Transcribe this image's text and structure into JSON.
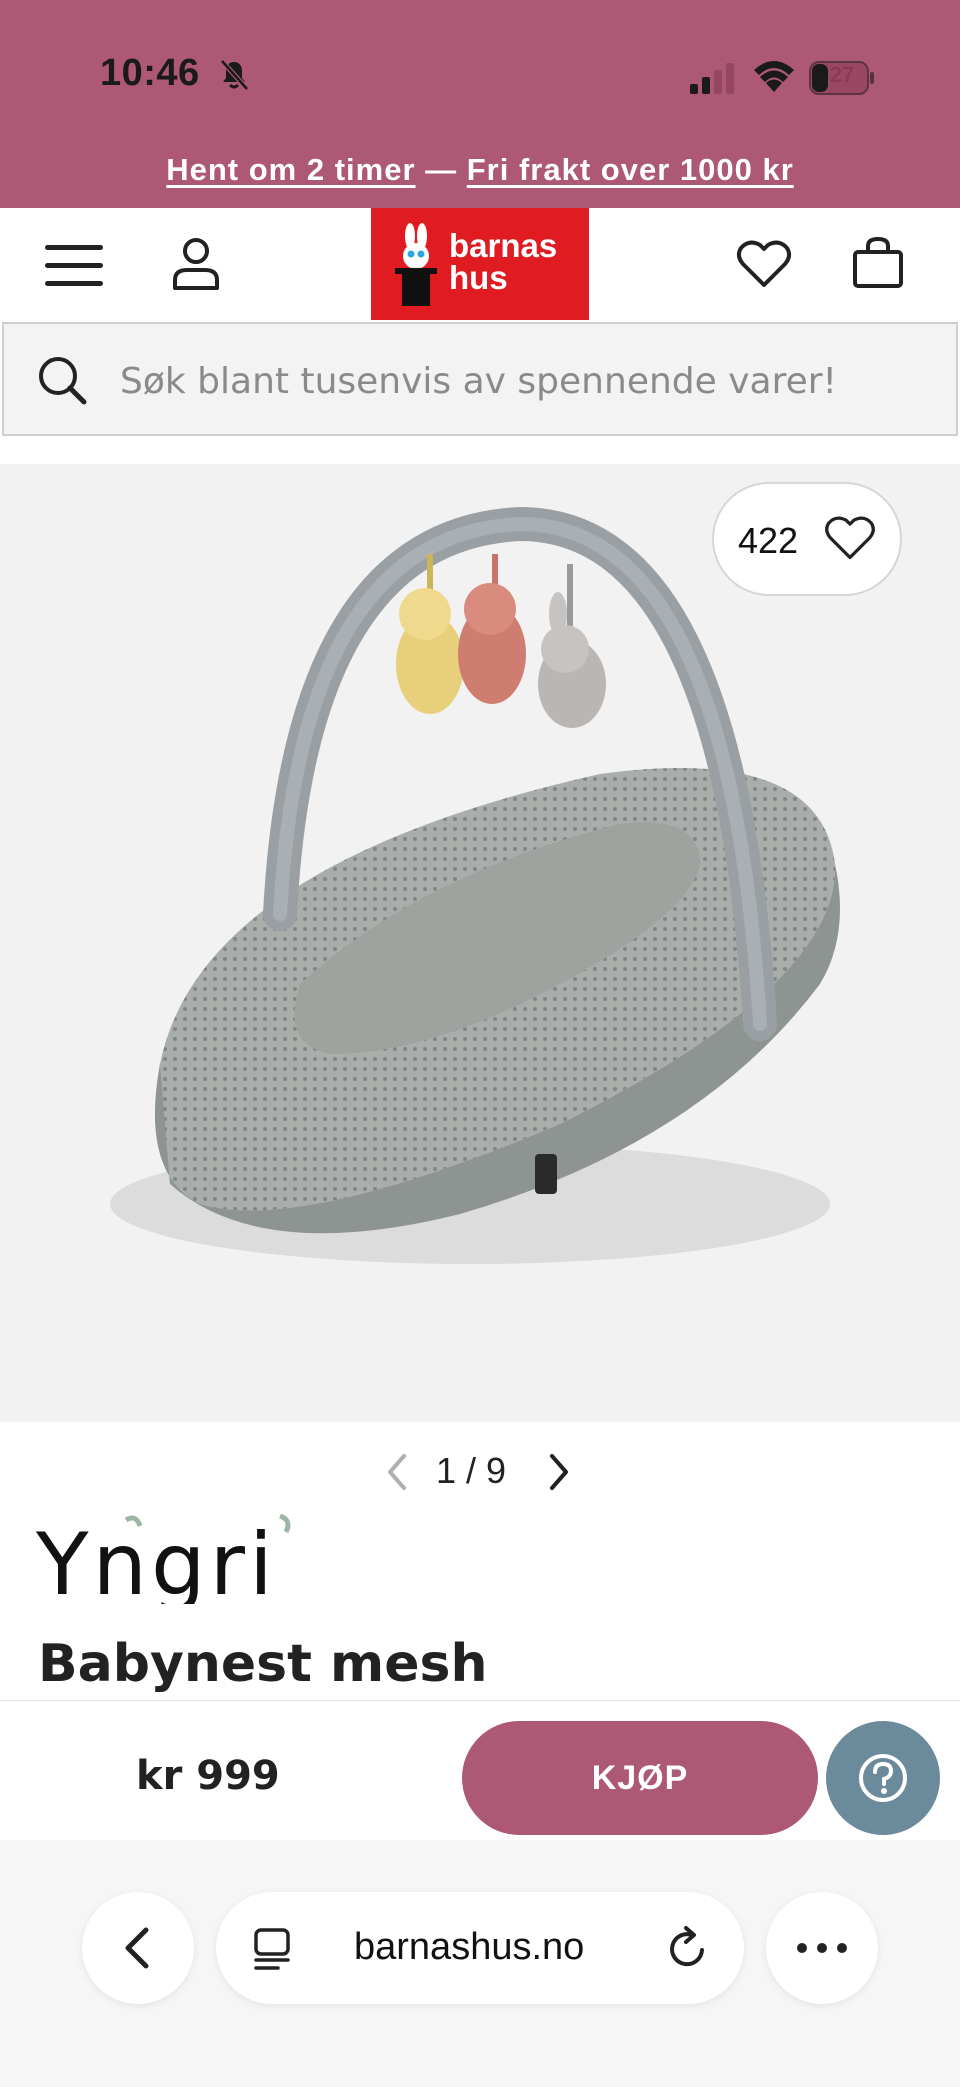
{
  "status_bar": {
    "time": "10:46",
    "battery": "27"
  },
  "promo": {
    "link1": "Hent om 2 timer",
    "separator": " — ",
    "link2": "Fri frakt over 1000 kr"
  },
  "header": {
    "logo_line1": "barnas",
    "logo_line2": "hus"
  },
  "search": {
    "placeholder": "Søk blant tusenvis av spennende varer!"
  },
  "product": {
    "like_count": "422",
    "image_index": "1",
    "image_total": "9",
    "pager_text": "1 / 9",
    "brand": "Yngri",
    "title": "Babynest mesh",
    "price": "kr 999"
  },
  "buybar": {
    "buy_label": "KJØP"
  },
  "browser": {
    "url": "barnashus.no"
  },
  "colors": {
    "brand_pink": "#ad5874",
    "logo_red": "#e11b22",
    "help_blue": "#6b8a9c"
  }
}
